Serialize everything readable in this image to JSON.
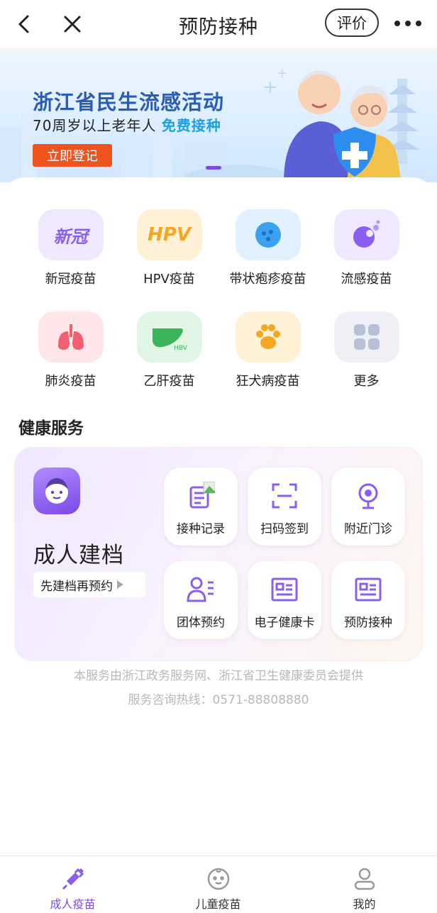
{
  "header": {
    "title": "预防接种",
    "rate_label": "评价",
    "back_icon": "back-arrow-icon",
    "close_icon": "close-icon",
    "more_icon": "more-dots-icon"
  },
  "banner": {
    "title": "浙江省民生流感活动",
    "subtitle_prefix": "70周岁以上老年人 ",
    "subtitle_highlight": "免费接种",
    "button_label": "立即登记"
  },
  "vaccines": [
    {
      "label": "新冠疫苗",
      "icon": "covid-icon",
      "icon_text": "新冠",
      "bg": "#efe8ff"
    },
    {
      "label": "HPV疫苗",
      "icon": "hpv-icon",
      "icon_text": "HPV",
      "bg": "#fff1d6"
    },
    {
      "label": "带状疱疹疫苗",
      "icon": "herpes-zoster-icon",
      "icon_text": "",
      "bg": "#e2f1ff"
    },
    {
      "label": "流感疫苗",
      "icon": "flu-icon",
      "icon_text": "",
      "bg": "#efe8ff"
    },
    {
      "label": "肺炎疫苗",
      "icon": "lungs-icon",
      "icon_text": "",
      "bg": "#ffe6e8"
    },
    {
      "label": "乙肝疫苗",
      "icon": "liver-icon",
      "icon_text": "HBV",
      "bg": "#e2f6e6"
    },
    {
      "label": "狂犬病疫苗",
      "icon": "paw-icon",
      "icon_text": "",
      "bg": "#fff1d6"
    },
    {
      "label": "更多",
      "icon": "grid-more-icon",
      "icon_text": "",
      "bg": "#eef0f6"
    }
  ],
  "health": {
    "section_title": "健康服务",
    "card_title": "成人建档",
    "pill_label": "先建档再预约",
    "tiles": [
      {
        "label": "接种记录",
        "icon": "record-icon"
      },
      {
        "label": "扫码签到",
        "icon": "scan-icon"
      },
      {
        "label": "附近门诊",
        "icon": "location-icon"
      },
      {
        "label": "团体预约",
        "icon": "group-icon"
      },
      {
        "label": "电子健康卡",
        "icon": "health-card-icon"
      },
      {
        "label": "预防接种",
        "icon": "vaccination-card-icon"
      }
    ]
  },
  "footer": {
    "line1": "本服务由浙江政务服务网、浙江省卫生健康委员会提供",
    "line2": "服务咨询热线：0571-88808880"
  },
  "tabbar": [
    {
      "label": "成人疫苗",
      "icon": "syringe-icon",
      "active": true
    },
    {
      "label": "儿童疫苗",
      "icon": "baby-face-icon",
      "active": false
    },
    {
      "label": "我的",
      "icon": "user-icon",
      "active": false
    }
  ],
  "colors": {
    "accent": "#7b4be8",
    "banner_button": "#f0541e",
    "banner_title": "#2a5db8"
  }
}
